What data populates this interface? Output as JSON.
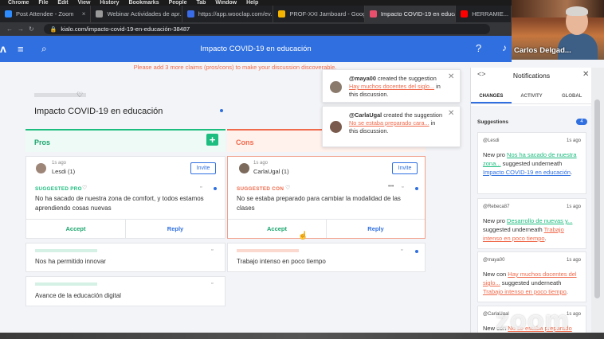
{
  "os_menu": [
    "Chrome",
    "File",
    "Edit",
    "View",
    "History",
    "Bookmarks",
    "People",
    "Tab",
    "Window",
    "Help"
  ],
  "browser": {
    "tabs": [
      {
        "label": "Post Attendee - Zoom",
        "color": "#2d8cff"
      },
      {
        "label": "Webinar Actividades de apr...",
        "color": "#999999"
      },
      {
        "label": "https://app.wooclap.com/ev...",
        "color": "#3a6ce8"
      },
      {
        "label": "PROF-XXI Jamboard - Googl...",
        "color": "#f4b400"
      },
      {
        "label": "Impacto COVID-19 en educa...",
        "color": "#e94f6c"
      },
      {
        "label": "HERRAMIE...",
        "color": "#ff0000"
      }
    ],
    "url": "kialo.com/impacto-covid-19-en-educación-38487"
  },
  "webcam": {
    "name": "Carlos Delgad..."
  },
  "header": {
    "title": "Impacto COVID-19 en educación"
  },
  "notice": "Please add 3 more claims (pros/cons) to make your discussion discoverable.",
  "discussion": {
    "title": "Impacto COVID-19 en educación"
  },
  "columns": {
    "pros": "Pros",
    "cons": "Cons"
  },
  "pro_card": {
    "ago": "1s ago",
    "user": "Lesdi (1)",
    "invite": "Invite",
    "tag": "SUGGESTED PRO",
    "text": "No ha sacado de nuestra zona de comfort, y todos estamos aprendiendo cosas nuevas",
    "accept": "Accept",
    "reply": "Reply"
  },
  "con_card": {
    "ago": "1s ago",
    "user": "CarlaUgal (1)",
    "invite": "Invite",
    "tag": "SUGGESTED CON",
    "text": "No se estaba preparado para cambiar la modalidad de las clases",
    "accept": "Accept",
    "reply": "Reply"
  },
  "claims": {
    "pro_2": "Nos ha permitido innovar",
    "pro_3": "Avance de la educación digital",
    "con_2": "Trabajo intenso en poco tiempo"
  },
  "popups": [
    {
      "user": "@maya00",
      "action": "created the suggestion",
      "link": "Hay muchos docentes del siglo...",
      "tail": "in this discussion."
    },
    {
      "user": "@CarlaUgal",
      "action": "created the suggestion",
      "link": "No se estaba preparado cara...",
      "tail": "in this discussion."
    }
  ],
  "notifications": {
    "title": "Notifications",
    "tabs": [
      "CHANGES",
      "ACTIVITY",
      "GLOBAL"
    ],
    "section": "Suggestions",
    "count": "4",
    "items": [
      {
        "user": "@Lesdi",
        "ago": "1s ago",
        "kind": "New pro",
        "link": "Nos ha sacado de nuestra zona...",
        "mid": "suggested underneath",
        "target": "Impacto COVID-19 en educación",
        "end": "."
      },
      {
        "user": "@Rebeca87",
        "ago": "1s ago",
        "kind": "New pro",
        "link": "Desarrollo de nuevas y...",
        "mid": "suggested underneath",
        "target": "Trabajo intenso en poco tiempo",
        "end": "."
      },
      {
        "user": "@maya00",
        "ago": "1s ago",
        "kind": "New con",
        "link": "Hay muchos docentes del siglo...",
        "mid": "suggested underneath",
        "target": "Trabajo intenso en poco tiempo",
        "end": "."
      },
      {
        "user": "@CarlaUgal",
        "ago": "1s ago",
        "kind": "New con",
        "link": "No se estaba preparado",
        "mid": "",
        "target": "",
        "end": ""
      }
    ]
  },
  "zoom_watermark": "zoom"
}
